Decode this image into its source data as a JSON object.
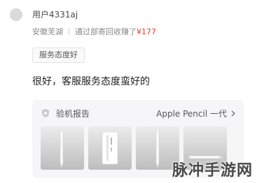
{
  "review": {
    "username": "用户4331aj",
    "location": "安徽芜湖",
    "purchase_text": "通过部寄回收赚了",
    "price": "¥177",
    "tag": "服务态度好",
    "text": "很好，客服服务态度蛮好的"
  },
  "inspection": {
    "label": "验机报告",
    "product": "Apple Pencil 一代",
    "icon": "inspection-icon",
    "thumbnails": [
      "pencil-photo-1",
      "pencil-photo-2",
      "pencil-photo-3",
      "pencil-photo-4"
    ]
  },
  "watermark": "脉冲手游网",
  "colors": {
    "price": "#e0402d",
    "card_bg": "#f6f6f8"
  }
}
